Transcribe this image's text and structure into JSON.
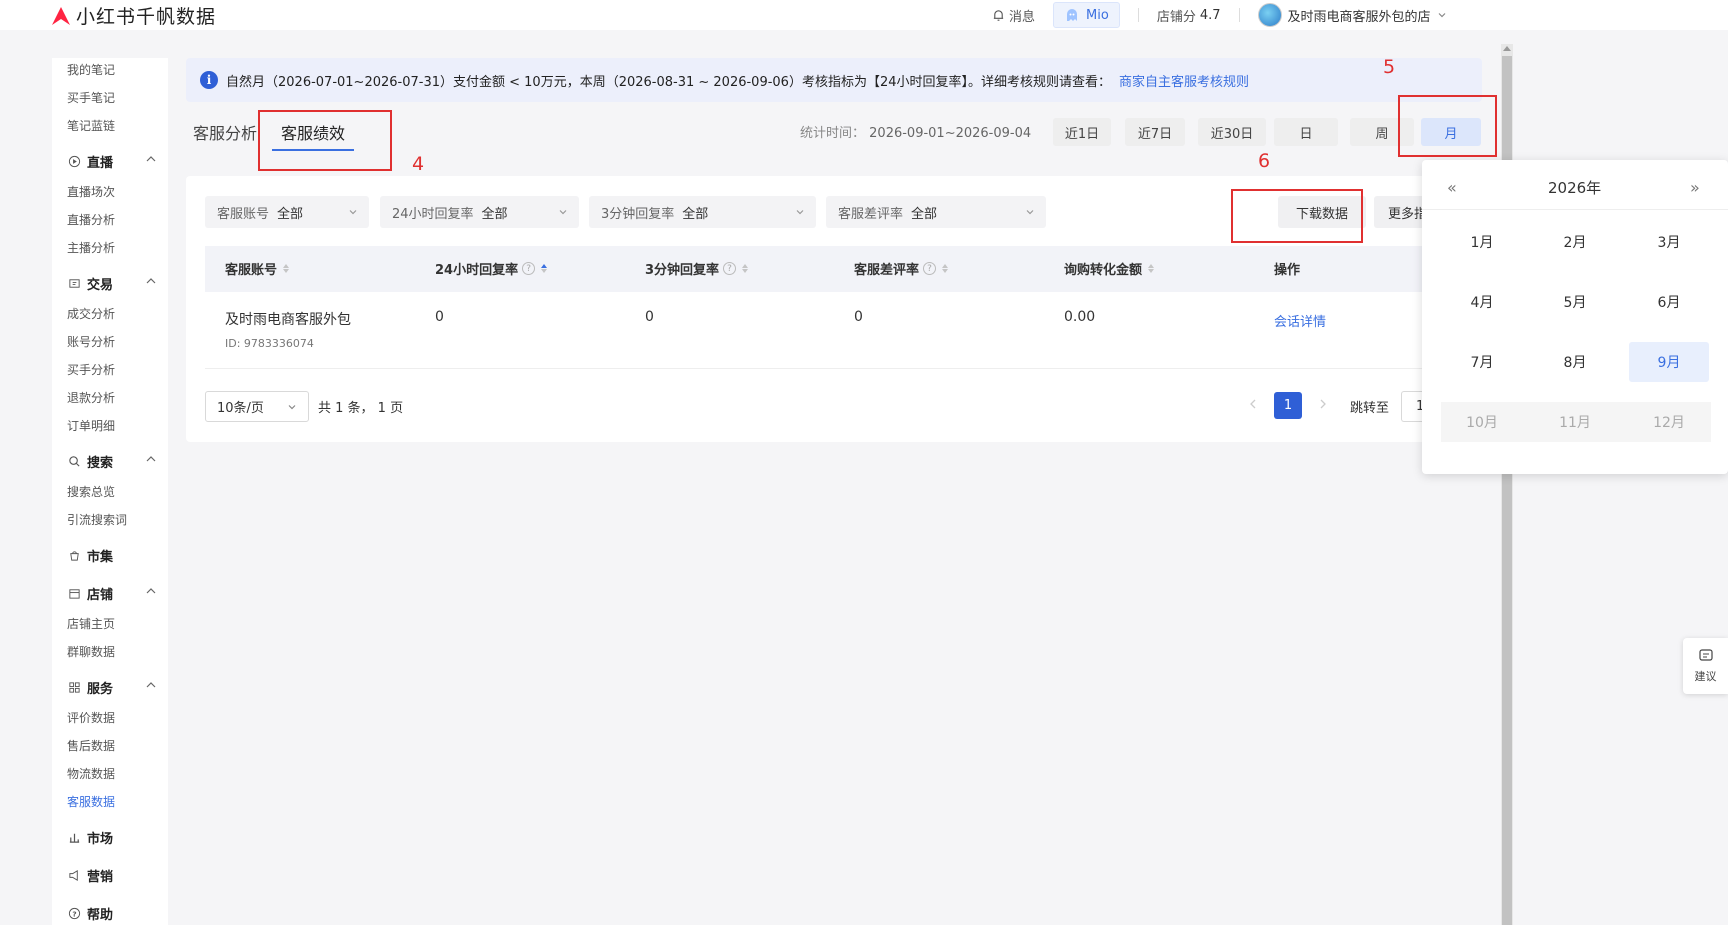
{
  "header": {
    "logo_text": "小红书千帆数据",
    "messages": "消息",
    "mio": "Mio",
    "score_label": "店铺分",
    "score_value": "4.7",
    "shop_name": "及时雨电商客服外包的店"
  },
  "sidebar": {
    "links_top": [
      "我的笔记",
      "买手笔记",
      "笔记蓝链"
    ],
    "groups": [
      {
        "label": "直播",
        "items": [
          "直播场次",
          "直播分析",
          "主播分析"
        ]
      },
      {
        "label": "交易",
        "items": [
          "成交分析",
          "账号分析",
          "买手分析",
          "退款分析",
          "订单明细"
        ]
      },
      {
        "label": "搜索",
        "items": [
          "搜索总览",
          "引流搜索词"
        ]
      },
      {
        "label": "市集",
        "items": []
      },
      {
        "label": "店铺",
        "items": [
          "店铺主页",
          "群聊数据"
        ]
      },
      {
        "label": "服务",
        "items": [
          "评价数据",
          "售后数据",
          "物流数据",
          "客服数据"
        ]
      },
      {
        "label": "市场",
        "items": []
      },
      {
        "label": "营销",
        "items": []
      },
      {
        "label": "帮助",
        "items": []
      }
    ]
  },
  "notice": {
    "text": "自然月（2026-07-01~2026-07-31）支付金额 < 10万元，本周（2026-08-31 ~ 2026-09-06）考核指标为【24小时回复率】。详细考核规则请查看：",
    "link": "商家自主客服考核规则"
  },
  "tabs": [
    "客服分析",
    "客服绩效"
  ],
  "stats": {
    "label": "统计时间：",
    "range": "2026-09-01~2026-09-04",
    "buttons": [
      "近1日",
      "近7日",
      "近30日",
      "日",
      "周",
      "月"
    ]
  },
  "filters": [
    {
      "label": "客服账号",
      "value": "全部"
    },
    {
      "label": "24小时回复率",
      "value": "全部"
    },
    {
      "label": "3分钟回复率",
      "value": "全部"
    },
    {
      "label": "客服差评率",
      "value": "全部"
    }
  ],
  "actions": {
    "download": "下载数据",
    "more": "更多指标"
  },
  "table": {
    "columns": [
      "客服账号",
      "24小时回复率",
      "3分钟回复率",
      "客服差评率",
      "询购转化金额",
      "操作"
    ],
    "rows": [
      {
        "name": "及时雨电商客服外包",
        "id": "ID: 9783336074",
        "c24": "0",
        "c3": "0",
        "bad": "0",
        "amount": "0.00",
        "action": "会话详情"
      }
    ]
  },
  "pagination": {
    "page_size": "10条/页",
    "total": "共 1 条， 1 页",
    "current": "1",
    "jump_label": "跳转至",
    "jump_value": "1"
  },
  "picker": {
    "year": "2026年",
    "months": [
      "1月",
      "2月",
      "3月",
      "4月",
      "5月",
      "6月",
      "7月",
      "8月",
      "9月",
      "10月",
      "11月",
      "12月"
    ],
    "selected": "9月"
  },
  "suggest": "建议",
  "annotations": [
    "4",
    "5",
    "6"
  ],
  "colors": {
    "accent": "#3a6fe0",
    "annotation": "#e03030"
  }
}
